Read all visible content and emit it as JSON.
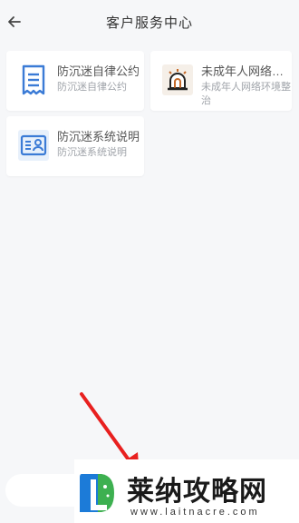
{
  "header": {
    "title": "客户服务中心"
  },
  "cards": [
    {
      "title": "防沉迷自律公约",
      "subtitle": "防沉迷自律公约",
      "icon": "document-icon"
    },
    {
      "title": "未成年人网络…",
      "subtitle": "未成年人网络环境整治",
      "icon": "alarm-siren-icon"
    },
    {
      "title": "防沉迷系统说明",
      "subtitle": "防沉迷系统说明",
      "icon": "id-card-icon"
    }
  ],
  "watermark": {
    "name": "莱纳攻略网",
    "url": "www.laitnacre.com",
    "logo_text": "L"
  },
  "colors": {
    "accent": "#3b7bd6",
    "siren": "#c56a2a",
    "arrow": "#e8201f"
  }
}
